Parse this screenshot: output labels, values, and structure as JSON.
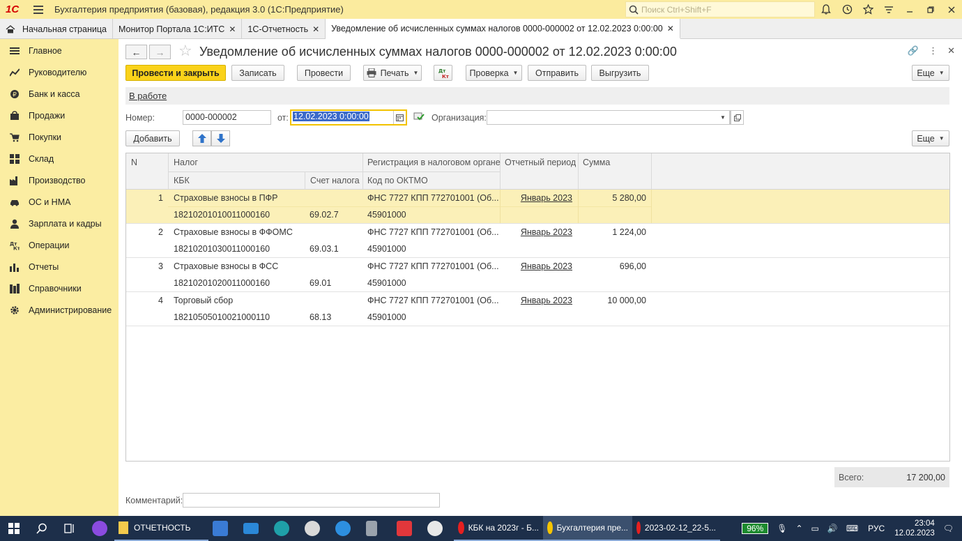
{
  "titlebar": {
    "logo": "1С",
    "title": "Бухгалтерия предприятия (базовая), редакция 3.0  (1С:Предприятие)",
    "search_placeholder": "Поиск Ctrl+Shift+F"
  },
  "tabs": [
    {
      "label": "Начальная страница"
    },
    {
      "label": "Монитор Портала 1С:ИТС"
    },
    {
      "label": "1С-Отчетность"
    },
    {
      "label": "Уведомление об исчисленных суммах налогов 0000-000002 от 12.02.2023 0:00:00"
    }
  ],
  "sidebar": {
    "items": [
      {
        "label": "Главное",
        "icon": "list-icon"
      },
      {
        "label": "Руководителю",
        "icon": "trend-icon"
      },
      {
        "label": "Банк и касса",
        "icon": "coin-icon"
      },
      {
        "label": "Продажи",
        "icon": "bag-icon"
      },
      {
        "label": "Покупки",
        "icon": "cart-icon"
      },
      {
        "label": "Склад",
        "icon": "grid-icon"
      },
      {
        "label": "Производство",
        "icon": "factory-icon"
      },
      {
        "label": "ОС и НМА",
        "icon": "car-icon"
      },
      {
        "label": "Зарплата и кадры",
        "icon": "person-icon"
      },
      {
        "label": "Операции",
        "icon": "dt-kt-icon"
      },
      {
        "label": "Отчеты",
        "icon": "bar-chart-icon"
      },
      {
        "label": "Справочники",
        "icon": "books-icon"
      },
      {
        "label": "Администрирование",
        "icon": "gear-icon"
      }
    ]
  },
  "form": {
    "title": "Уведомление об исчисленных суммах налогов 0000-000002 от 12.02.2023 0:00:00",
    "toolbar": {
      "post_close": "Провести и закрыть",
      "write": "Записать",
      "post": "Провести",
      "print": "Печать",
      "check": "Проверка",
      "send": "Отправить",
      "upload": "Выгрузить",
      "more": "Еще"
    },
    "status": "В работе",
    "number_label": "Номер:",
    "number_value": "0000-000002",
    "date_label": "от:",
    "date_value": "12.02.2023  0:00:00",
    "org_label": "Организация:",
    "org_value": "",
    "add_button": "Добавить",
    "more2": "Еще",
    "comment_label": "Комментарий:",
    "comment_value": ""
  },
  "table": {
    "headers": {
      "n": "N",
      "tax": "Налог",
      "kbk": "КБК",
      "account": "Счет налога",
      "registration": "Регистрация в налоговом органе",
      "oktmo": "Код по ОКТМО",
      "period": "Отчетный период",
      "sum": "Сумма"
    },
    "rows": [
      {
        "n": "1",
        "tax": "Страховые взносы в ПФР",
        "kbk": "18210201010011000160",
        "account": "69.02.7",
        "registration": "ФНС 7727 КПП 772701001 (Об...",
        "oktmo": "45901000",
        "period": "Январь 2023",
        "sum": "5 280,00"
      },
      {
        "n": "2",
        "tax": "Страховые взносы в ФФОМС",
        "kbk": "18210201030011000160",
        "account": "69.03.1",
        "registration": "ФНС 7727 КПП 772701001 (Об...",
        "oktmo": "45901000",
        "period": "Январь 2023",
        "sum": "1 224,00"
      },
      {
        "n": "3",
        "tax": "Страховые взносы в ФСС",
        "kbk": "18210201020011000160",
        "account": "69.01",
        "registration": "ФНС 7727 КПП 772701001 (Об...",
        "oktmo": "45901000",
        "period": "Январь 2023",
        "sum": "696,00"
      },
      {
        "n": "4",
        "tax": "Торговый сбор",
        "kbk": "18210505010021000110",
        "account": "68.13",
        "registration": "ФНС 7727 КПП 772701001 (Об...",
        "oktmo": "45901000",
        "period": "Январь 2023",
        "sum": "10 000,00"
      }
    ],
    "total_label": "Всего:",
    "total_value": "17 200,00"
  },
  "taskbar": {
    "items": [
      {
        "label": "ОТЧЕТНОСТЬ"
      },
      {
        "label": "КБК на 2023г - Б..."
      },
      {
        "label": "Бухгалтерия пре..."
      },
      {
        "label": "2023-02-12_22-5..."
      }
    ],
    "battery": "96%",
    "lang": "РУС",
    "time": "23:04",
    "date": "12.02.2023"
  }
}
